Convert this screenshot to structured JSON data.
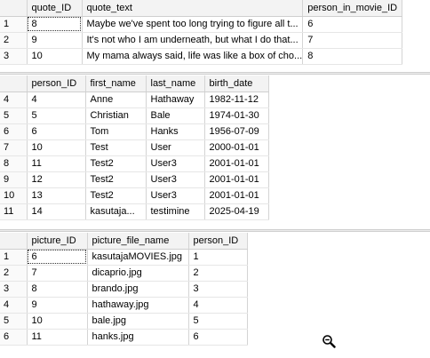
{
  "quotes": {
    "columns": [
      "quote_ID",
      "quote_text",
      "person_in_movie_ID"
    ],
    "rows": [
      {
        "n": "1",
        "cells": [
          "8",
          "Maybe we've spent too long trying to figure all t...",
          "6"
        ]
      },
      {
        "n": "2",
        "cells": [
          "9",
          "It's not who I am underneath, but what I do that...",
          "7"
        ]
      },
      {
        "n": "3",
        "cells": [
          "10",
          "My mama always said, life was like a box of cho...",
          "8"
        ]
      }
    ]
  },
  "persons": {
    "columns": [
      "person_ID",
      "first_name",
      "last_name",
      "birth_date"
    ],
    "rows": [
      {
        "n": "4",
        "cells": [
          "4",
          "Anne",
          "Hathaway",
          "1982-11-12"
        ]
      },
      {
        "n": "5",
        "cells": [
          "5",
          "Christian",
          "Bale",
          "1974-01-30"
        ]
      },
      {
        "n": "6",
        "cells": [
          "6",
          "Tom",
          "Hanks",
          "1956-07-09"
        ]
      },
      {
        "n": "7",
        "cells": [
          "10",
          "Test",
          "User",
          "2000-01-01"
        ]
      },
      {
        "n": "8",
        "cells": [
          "11",
          "Test2",
          "User3",
          "2001-01-01"
        ]
      },
      {
        "n": "9",
        "cells": [
          "12",
          "Test2",
          "User3",
          "2001-01-01"
        ]
      },
      {
        "n": "10",
        "cells": [
          "13",
          "Test2",
          "User3",
          "2001-01-01"
        ]
      },
      {
        "n": "11",
        "cells": [
          "14",
          "kasutaja...",
          "testimine",
          "2025-04-19"
        ]
      }
    ]
  },
  "pictures": {
    "columns": [
      "picture_ID",
      "picture_file_name",
      "person_ID"
    ],
    "rows": [
      {
        "n": "1",
        "cells": [
          "6",
          "kasutajaMOVIES.jpg",
          "1"
        ]
      },
      {
        "n": "2",
        "cells": [
          "7",
          "dicaprio.jpg",
          "2"
        ]
      },
      {
        "n": "3",
        "cells": [
          "8",
          "brando.jpg",
          "3"
        ]
      },
      {
        "n": "4",
        "cells": [
          "9",
          "hathaway.jpg",
          "4"
        ]
      },
      {
        "n": "5",
        "cells": [
          "10",
          "bale.jpg",
          "5"
        ]
      },
      {
        "n": "6",
        "cells": [
          "11",
          "hanks.jpg",
          "6"
        ]
      }
    ]
  },
  "icons": {
    "cursor": "zoom-magnifier-icon"
  }
}
